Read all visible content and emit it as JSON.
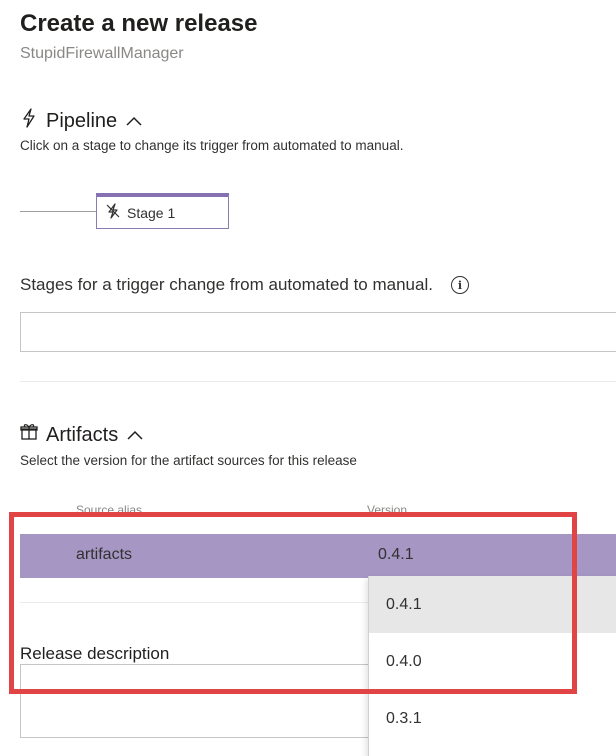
{
  "header": {
    "title": "Create a new release",
    "subtitle": "StupidFirewallManager"
  },
  "pipeline": {
    "heading": "Pipeline",
    "heading_icon": "lightning-icon",
    "description": "Click on a stage to change its trigger from automated to manual.",
    "stage": {
      "label": "Stage 1"
    },
    "stages_label": "Stages for a trigger change from automated to manual.",
    "stages_input_value": ""
  },
  "artifacts": {
    "heading": "Artifacts",
    "heading_icon": "gift-icon",
    "description": "Select the version for the artifact sources for this release",
    "columns": {
      "source_alias": "Source alias",
      "version": "Version"
    },
    "row": {
      "alias": "artifacts",
      "version": "0.4.1"
    },
    "version_options": [
      "0.4.1",
      "0.4.0",
      "0.3.1"
    ],
    "selected_option_index": 0
  },
  "release": {
    "description_label": "Release description",
    "description_value": ""
  },
  "colors": {
    "accent": "#8672b3",
    "selected_row": "#a596c4",
    "highlight_box": "#e04444"
  }
}
